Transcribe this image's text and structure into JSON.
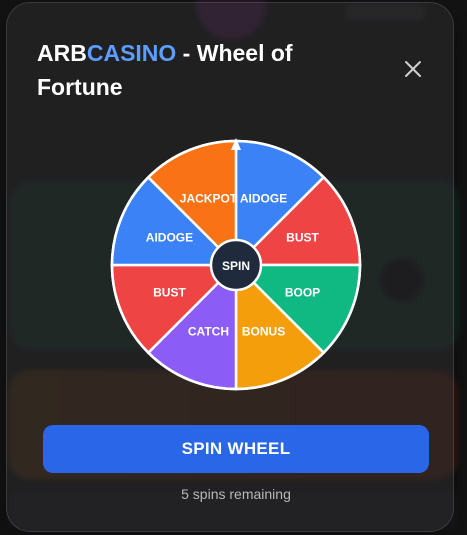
{
  "modal": {
    "title_brand_part1": "ARB",
    "title_brand_part2": "CASINO",
    "title_rest": " - Wheel of Fortune",
    "spin_button_label": "SPIN WHEEL",
    "spins_remaining_text": "5 spins remaining",
    "close_icon": "close-icon"
  },
  "wheel": {
    "center_label": "SPIN",
    "segments": [
      {
        "label": "AIDOGE",
        "color": "#3b82f6"
      },
      {
        "label": "BUST",
        "color": "#ef4444"
      },
      {
        "label": "BOOP",
        "color": "#10b981"
      },
      {
        "label": "BONUS",
        "color": "#f59e0b"
      },
      {
        "label": "CATCH",
        "color": "#8b5cf6"
      },
      {
        "label": "BUST",
        "color": "#ef4444"
      },
      {
        "label": "AIDOGE",
        "color": "#3b82f6"
      },
      {
        "label": "JACKPOT",
        "color": "#f97316"
      }
    ],
    "pointer_icon": "arrow-up-icon"
  },
  "colors": {
    "accent_blue": "#5c9dff",
    "button_blue": "#2a66e8"
  }
}
